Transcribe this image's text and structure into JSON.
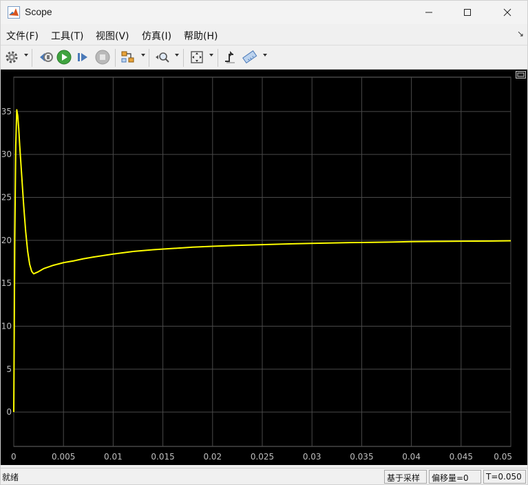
{
  "window": {
    "title": "Scope"
  },
  "menu": {
    "items": [
      "文件(F)",
      "工具(T)",
      "视图(V)",
      "仿真(I)",
      "帮助(H)"
    ]
  },
  "toolbar": {
    "buttons": [
      {
        "name": "configuration-properties",
        "icon": "gear-icon"
      },
      {
        "name": "step-back",
        "icon": "step-back-icon"
      },
      {
        "name": "run",
        "icon": "play-icon"
      },
      {
        "name": "step-forward",
        "icon": "step-forward-icon"
      },
      {
        "name": "stop",
        "icon": "stop-icon"
      },
      {
        "name": "highlight-simulink-block",
        "icon": "block-icon"
      },
      {
        "name": "zoom",
        "icon": "zoom-icon"
      },
      {
        "name": "scale-axes",
        "icon": "fit-axes-icon"
      },
      {
        "name": "triggers",
        "icon": "trigger-icon"
      },
      {
        "name": "cursor-measurements",
        "icon": "ruler-icon"
      }
    ]
  },
  "status": {
    "text": "就绪",
    "sample_mode": "基于采样",
    "offset": "偏移量=0",
    "time": "T=0.050"
  },
  "colors": {
    "plot_background": "#000000",
    "grid": "#4a4a4a",
    "trace": "#ffff00",
    "tick_text": "#bfbfbf"
  },
  "chart_data": {
    "type": "line",
    "title": "",
    "xlabel": "",
    "ylabel": "",
    "xlim": [
      0,
      0.05
    ],
    "ylim": [
      -4,
      39
    ],
    "xticks": [
      0,
      0.005,
      0.01,
      0.015,
      0.02,
      0.025,
      0.03,
      0.035,
      0.04,
      0.045,
      0.05
    ],
    "xtick_labels": [
      "0",
      "0.005",
      "0.01",
      "0.015",
      "0.02",
      "0.025",
      "0.03",
      "0.035",
      "0.04",
      "0.045",
      "0.05"
    ],
    "yticks": [
      0,
      5,
      10,
      15,
      20,
      25,
      30,
      35
    ],
    "ytick_labels": [
      "0",
      "5",
      "10",
      "15",
      "20",
      "25",
      "30",
      "35"
    ],
    "grid": true,
    "legend": "none",
    "series": [
      {
        "x": [
          0,
          0.0001,
          0.0002,
          0.0003,
          0.0004,
          0.0005,
          0.0006,
          0.0008,
          0.001,
          0.0012,
          0.0014,
          0.0016,
          0.0018,
          0.002,
          0.0022,
          0.0024,
          0.0027,
          0.003,
          0.0035,
          0.004,
          0.005,
          0.006,
          0.007,
          0.008,
          0.01,
          0.012,
          0.014,
          0.016,
          0.018,
          0.02,
          0.022,
          0.025,
          0.028,
          0.03,
          0.033,
          0.035,
          0.038,
          0.04,
          0.043,
          0.045,
          0.048,
          0.05
        ],
        "y": [
          0,
          20,
          31,
          35.2,
          34.5,
          33,
          31,
          27.5,
          24,
          21,
          18.7,
          17.2,
          16.4,
          16.1,
          16.2,
          16.3,
          16.5,
          16.7,
          16.9,
          17.1,
          17.4,
          17.6,
          17.85,
          18.05,
          18.4,
          18.7,
          18.9,
          19.05,
          19.2,
          19.3,
          19.4,
          19.5,
          19.6,
          19.65,
          19.72,
          19.75,
          19.8,
          19.85,
          19.88,
          19.9,
          19.92,
          19.95
        ]
      }
    ]
  }
}
